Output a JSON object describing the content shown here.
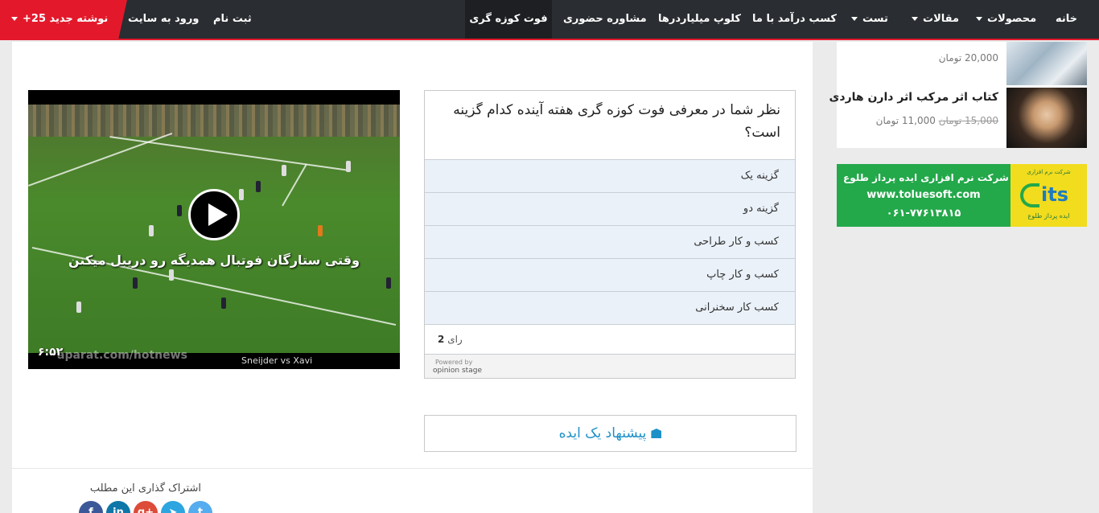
{
  "nav": {
    "items": [
      {
        "label": "خانه"
      },
      {
        "label": "محصولات"
      },
      {
        "label": "مقالات"
      },
      {
        "label": "تست"
      },
      {
        "label": "کسب درآمد با ما"
      },
      {
        "label": "کلوپ میلیاردرها"
      },
      {
        "label": "مشاوره حضوری"
      },
      {
        "label": "فوت کوزه گری"
      }
    ],
    "register": "ثبت نام",
    "login": "ورود به سایت",
    "new_posts": "+25 نوشته جدید"
  },
  "video": {
    "caption": "وقتی ستارگان فوتبال همدیگه رو دریبل میکنن",
    "duration": "۶:۵۲",
    "watermark": "aparat.com/hotnews",
    "label": "Sneijder vs Xavi"
  },
  "poll": {
    "question": "نظر شما در معرفی فوت کوزه گری هفته آینده کدام گزینه است؟",
    "options": [
      {
        "label": "گزینه یک"
      },
      {
        "label": "گزینه دو"
      },
      {
        "label": "کسب و کار طراحی"
      },
      {
        "label": "کسب و کار چاپ"
      },
      {
        "label": "کسب کار سخنرانی"
      }
    ],
    "votes_label": "رای",
    "votes_count": "2",
    "powered_by": "Powered by",
    "brand": "opinion stage"
  },
  "suggest_button": "پیشنهاد یک ایده",
  "share": {
    "title": "اشتراک گذاری این مطلب",
    "icons": [
      {
        "name": "facebook-icon",
        "glyph": "f",
        "color": "#3b5998"
      },
      {
        "name": "linkedin-icon",
        "glyph": "in",
        "color": "#0e76a8"
      },
      {
        "name": "google-plus-icon",
        "glyph": "g+",
        "color": "#dd4b39"
      },
      {
        "name": "telegram-icon",
        "glyph": "➤",
        "color": "#2ca5e0"
      },
      {
        "name": "twitter-icon",
        "glyph": "t",
        "color": "#55acee"
      }
    ]
  },
  "sidebar": {
    "products": [
      {
        "price": "20,000",
        "currency": "تومان"
      },
      {
        "title": "کتاب اثر مرکب اثر دارن هاردی",
        "old_price": "15,000",
        "old_currency": "تومان",
        "price": "11,000",
        "currency": "تومان"
      }
    ],
    "ad": {
      "line1": "شرکت نرم افزاری ایده پرداز طلوع",
      "line2": "www.toluesoft.com",
      "line3": "۰۶۱-۷۷۶۱۳۸۱۵",
      "logo_text": "ایده پرداز طلوع",
      "logo_top": "شرکت نرم افزاری"
    }
  },
  "colors": {
    "nav_bg": "#2a2d31",
    "accent_red": "#e3192b",
    "link_blue": "#1e90c8",
    "poll_option_bg": "#eaf1f9",
    "ad_green": "#23a84a",
    "ad_yellow": "#f2dc1e"
  }
}
